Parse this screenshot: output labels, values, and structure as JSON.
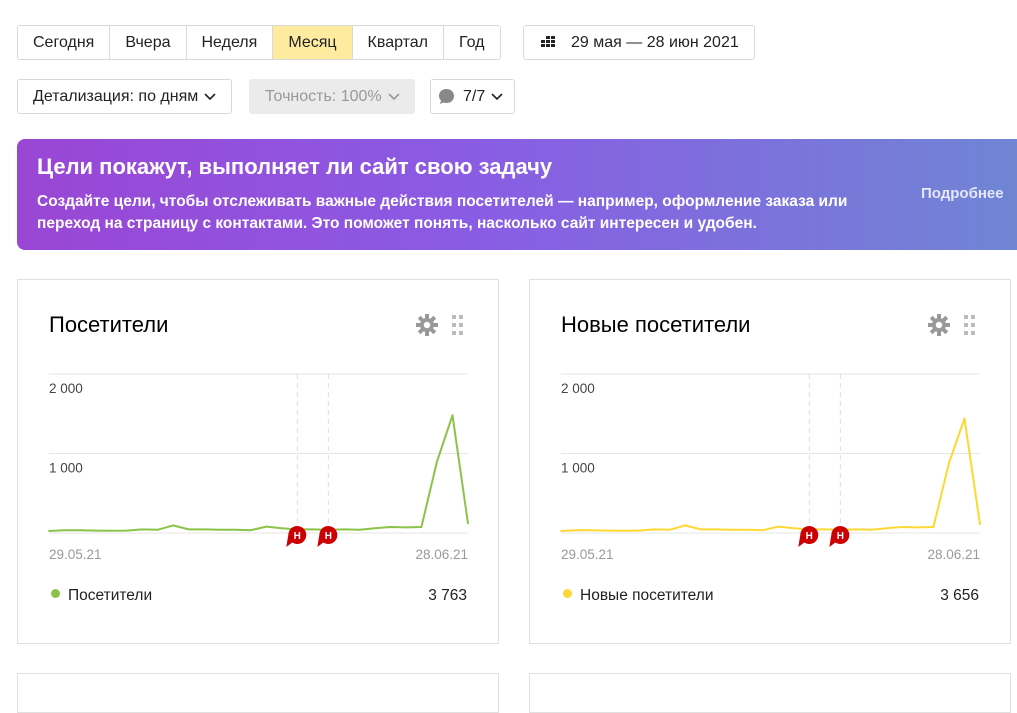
{
  "period": {
    "buttons": [
      "Сегодня",
      "Вчера",
      "Неделя",
      "Месяц",
      "Квартал",
      "Год"
    ],
    "active": "Месяц",
    "date_range": "29 мая — 28 июн 2021"
  },
  "controls": {
    "detail": "Детализация: по дням",
    "accuracy": "Точность: 100%",
    "segments": "7/7"
  },
  "banner": {
    "title": "Цели покажут, выполняет ли сайт свою задачу",
    "text": "Создайте цели, чтобы отслеживать важные действия посетителей — например, оформление заказа или переход на страницу с контактами. Это поможет понять, насколько сайт интересен и удобен.",
    "more": "Подробнее"
  },
  "colors": {
    "visitors": "#8bc34a",
    "new_visitors": "#fdd835",
    "annotation": "#cc0000"
  },
  "cards": [
    {
      "title": "Посетители",
      "legend_label": "Посетители",
      "total": "3 763",
      "color_key": "visitors",
      "chart_data": {
        "type": "line",
        "ylabels": [
          "2 000",
          "1 000"
        ],
        "ylim": [
          0,
          2000
        ],
        "x_start_label": "29.05.21",
        "x_end_label": "28.06.21",
        "annotation_label": "Н",
        "annotation_days": [
          16,
          18
        ],
        "series": [
          {
            "name": "Посетители",
            "values": [
              25,
              35,
              35,
              30,
              28,
              30,
              45,
              40,
              95,
              45,
              45,
              40,
              40,
              35,
              80,
              60,
              45,
              45,
              40,
              45,
              40,
              60,
              75,
              70,
              75,
              900,
              1480,
              120
            ]
          }
        ]
      }
    },
    {
      "title": "Новые посетители",
      "legend_label": "Новые посетители",
      "total": "3 656",
      "color_key": "new_visitors",
      "chart_data": {
        "type": "line",
        "ylabels": [
          "2 000",
          "1 000"
        ],
        "ylim": [
          0,
          2000
        ],
        "x_start_label": "29.05.21",
        "x_end_label": "28.06.21",
        "annotation_label": "Н",
        "annotation_days": [
          16,
          18
        ],
        "series": [
          {
            "name": "Новые посетители",
            "values": [
              25,
              35,
              35,
              30,
              28,
              30,
              45,
              40,
              95,
              45,
              45,
              40,
              40,
              35,
              80,
              60,
              45,
              45,
              40,
              45,
              40,
              60,
              75,
              70,
              75,
              880,
              1440,
              110
            ]
          }
        ]
      }
    }
  ]
}
